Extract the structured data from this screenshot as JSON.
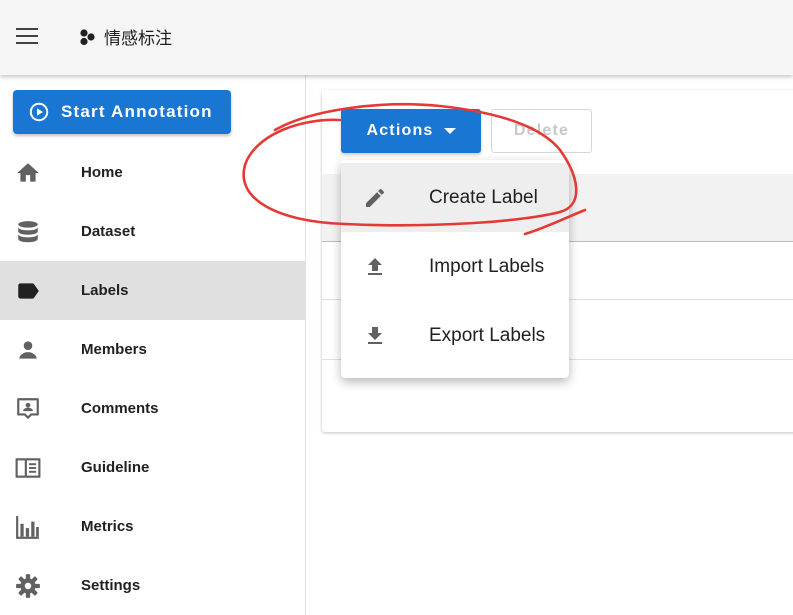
{
  "app": {
    "title": "情感标注"
  },
  "sidebar": {
    "start_label": "Start Annotation",
    "items": [
      {
        "label": "Home",
        "icon": "home-icon"
      },
      {
        "label": "Dataset",
        "icon": "database-icon"
      },
      {
        "label": "Labels",
        "icon": "label-icon",
        "active": true
      },
      {
        "label": "Members",
        "icon": "person-icon"
      },
      {
        "label": "Comments",
        "icon": "comment-icon"
      },
      {
        "label": "Guideline",
        "icon": "book-icon"
      },
      {
        "label": "Metrics",
        "icon": "bar-chart-icon"
      },
      {
        "label": "Settings",
        "icon": "gear-icon"
      }
    ]
  },
  "toolbar": {
    "actions_label": "Actions",
    "delete_label": "Delete"
  },
  "actions_menu": {
    "items": [
      {
        "label": "Create Label",
        "icon": "pencil-icon"
      },
      {
        "label": "Import Labels",
        "icon": "upload-icon"
      },
      {
        "label": "Export Labels",
        "icon": "download-icon"
      }
    ]
  },
  "colors": {
    "primary": "#1976d2",
    "annotation": "#e53935",
    "active_nav": "#e0e0e0"
  }
}
